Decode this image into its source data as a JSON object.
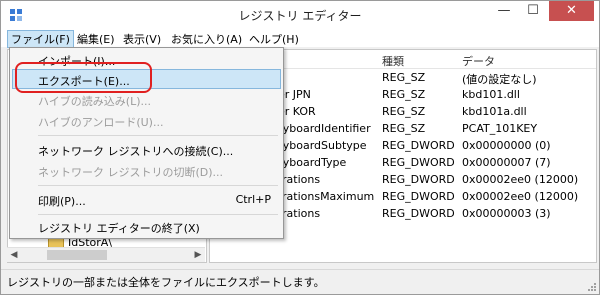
{
  "window": {
    "title": "レジストリ エディター",
    "min_glyph": "—",
    "max_glyph": "☐",
    "close_glyph": "✕"
  },
  "menubar": {
    "items": [
      "ファイル(F)",
      "編集(E)",
      "表示(V)",
      "お気に入り(A)",
      "ヘルプ(H)"
    ]
  },
  "list": {
    "headers": {
      "type": "種類",
      "data": "データ"
    },
    "rows": [
      {
        "name": "",
        "type": "REG_SZ",
        "data": "(値の設定なし)"
      },
      {
        "name": "er JPN",
        "type": "REG_SZ",
        "data": "kbd101.dll"
      },
      {
        "name": "er KOR",
        "type": "REG_SZ",
        "data": "kbd101a.dll"
      },
      {
        "name": "eyboardIdentifier",
        "type": "REG_SZ",
        "data": "PCAT_101KEY"
      },
      {
        "name": "eyboardSubtype",
        "type": "REG_DWORD",
        "data": "0x00000000 (0)"
      },
      {
        "name": "eyboardType",
        "type": "REG_DWORD",
        "data": "0x00000007 (7)"
      },
      {
        "name": "rations",
        "type": "REG_DWORD",
        "data": "0x00002ee0 (12000)"
      },
      {
        "name": "rationsMaximum",
        "type": "REG_DWORD",
        "data": "0x00002ee0 (12000)"
      },
      {
        "name": "rations",
        "type": "REG_DWORD",
        "data": "0x00000003 (3)"
      }
    ]
  },
  "tree": {
    "visible_node": "IdStorA\\"
  },
  "file_menu": {
    "items": [
      {
        "label": "インポート(I)...",
        "enabled": true
      },
      {
        "label": "エクスポート(E)...",
        "enabled": true,
        "highlighted": true
      },
      {
        "label": "ハイブの読み込み(L)...",
        "enabled": false
      },
      {
        "label": "ハイブのアンロード(U)...",
        "enabled": false
      },
      {
        "label": "ネットワーク レジストリへの接続(C)...",
        "enabled": true
      },
      {
        "label": "ネットワーク レジストリの切断(D)...",
        "enabled": false
      },
      {
        "label": "印刷(P)...",
        "enabled": true,
        "shortcut": "Ctrl+P"
      },
      {
        "label": "レジストリ エディターの終了(X)",
        "enabled": true
      }
    ]
  },
  "statusbar": {
    "text": "レジストリの一部または全体をファイルにエクスポートします。"
  },
  "colors": {
    "close_button": "#c75050",
    "highlight": "#cde6f7",
    "annotation": "#e02020"
  }
}
